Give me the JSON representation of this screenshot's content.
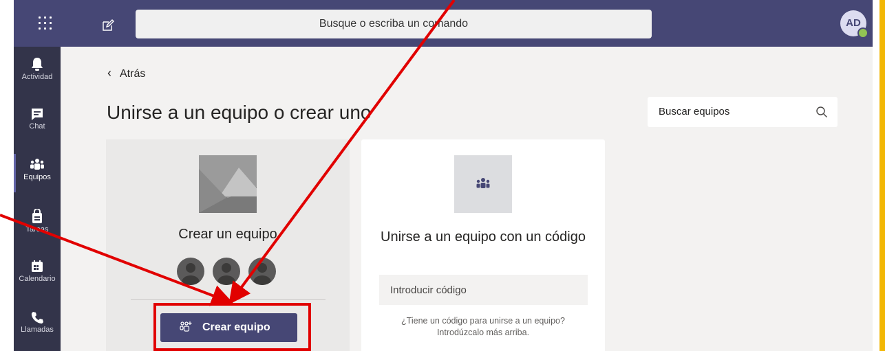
{
  "topbar": {
    "search_placeholder": "Busque o escriba un comando",
    "avatar_initials": "AD",
    "apps_icon": "grid-icon",
    "compose_icon": "compose-icon"
  },
  "rail": {
    "items": [
      {
        "label": "Actividad",
        "icon": "bell-icon"
      },
      {
        "label": "Chat",
        "icon": "chat-icon"
      },
      {
        "label": "Equipos",
        "icon": "teams-icon",
        "active": true
      },
      {
        "label": "Tareas",
        "icon": "bag-icon"
      },
      {
        "label": "Calendario",
        "icon": "calendar-icon"
      },
      {
        "label": "Llamadas",
        "icon": "phone-icon"
      }
    ]
  },
  "main": {
    "back_label": "Atrás",
    "title": "Unirse a un equipo o crear uno",
    "team_search_placeholder": "Buscar equipos"
  },
  "create_card": {
    "title": "Crear un equipo",
    "button_label": "Crear equipo"
  },
  "join_card": {
    "title": "Unirse a un equipo con un código",
    "code_placeholder": "Introducir código",
    "hint_line1": "¿Tiene un código para unirse a un equipo?",
    "hint_line2": "Introdúzcalo más arriba."
  },
  "colors": {
    "brand": "#464775",
    "rail": "#33344a",
    "annotation": "#e10000",
    "accent_edge": "#f2b705"
  }
}
